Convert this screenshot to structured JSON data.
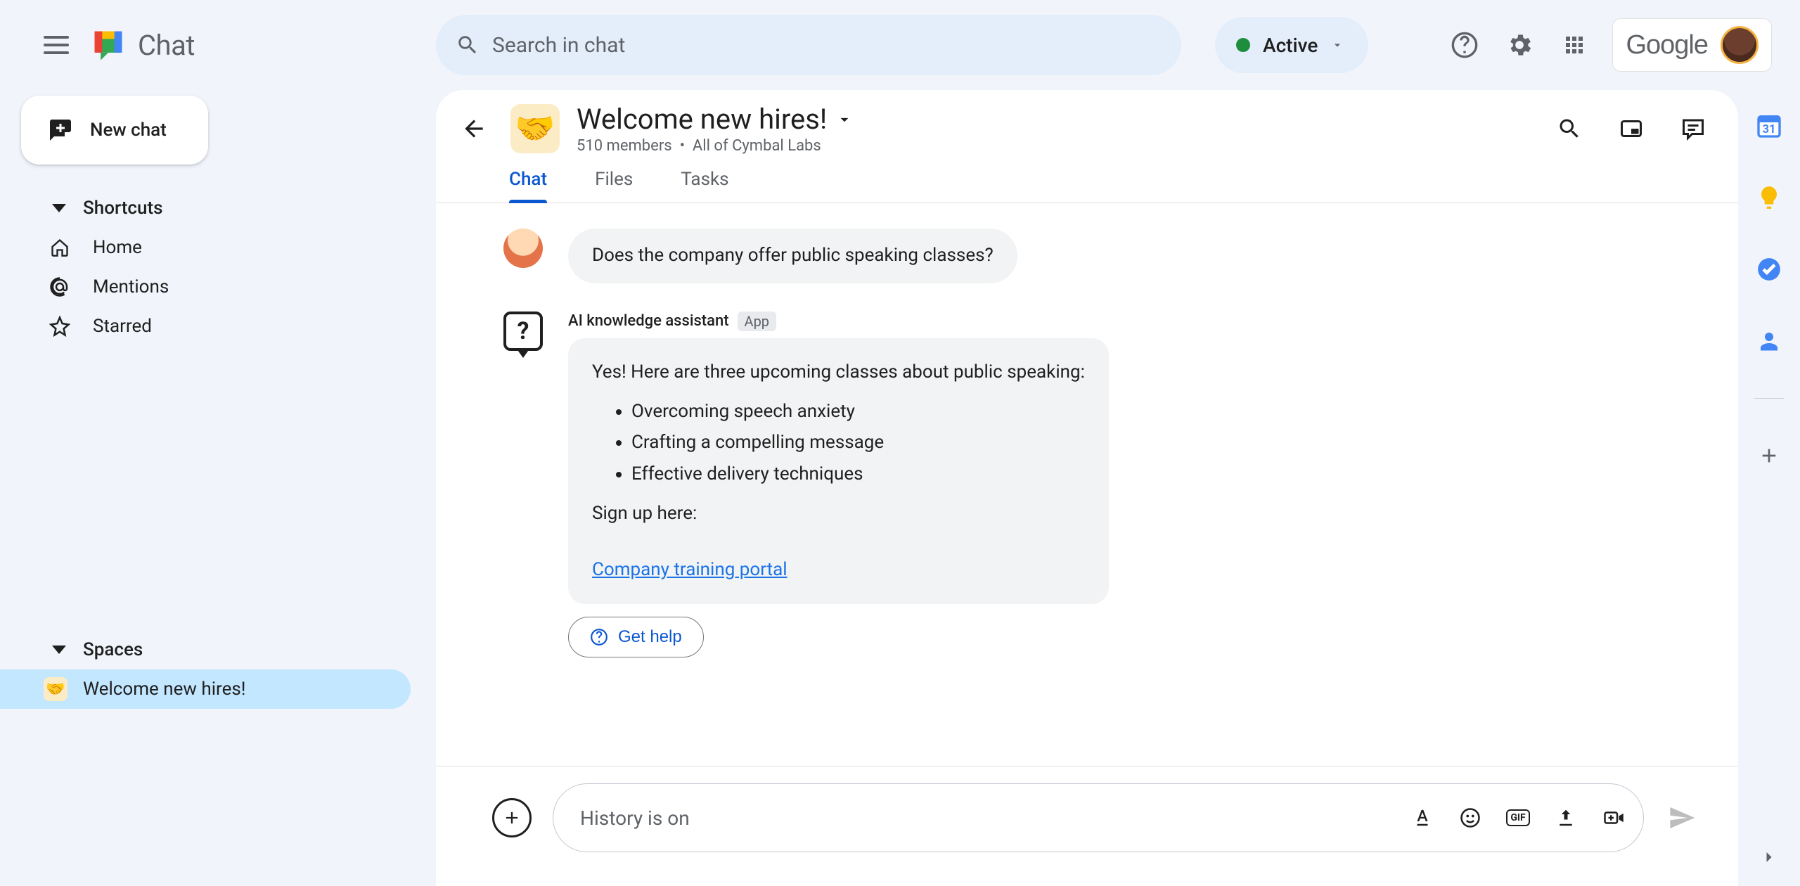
{
  "app_name": "Chat",
  "search": {
    "placeholder": "Search in chat"
  },
  "status": {
    "label": "Active"
  },
  "new_chat_label": "New chat",
  "sidebar": {
    "shortcuts_label": "Shortcuts",
    "home_label": "Home",
    "mentions_label": "Mentions",
    "starred_label": "Starred",
    "spaces_label": "Spaces",
    "space_name": "Welcome new hires!"
  },
  "room": {
    "emoji": "🤝",
    "title": "Welcome new hires!",
    "members": "510 members",
    "sep": "•",
    "org": "All of Cymbal Labs"
  },
  "tabs": {
    "chat": "Chat",
    "files": "Files",
    "tasks": "Tasks"
  },
  "messages": {
    "user_q": "Does the company offer public speaking classes?",
    "bot_name": "AI knowledge assistant",
    "app_badge": "App",
    "bot_intro": "Yes! Here are three upcoming classes about public speaking:",
    "bot_li1": "Overcoming speech anxiety",
    "bot_li2": "Crafting a compelling message",
    "bot_li3": "Effective delivery techniques",
    "bot_signup": "Sign up here:",
    "bot_link": "Company training portal",
    "get_help": "Get help"
  },
  "composer": {
    "placeholder": "History is on"
  },
  "google_label": "Google"
}
